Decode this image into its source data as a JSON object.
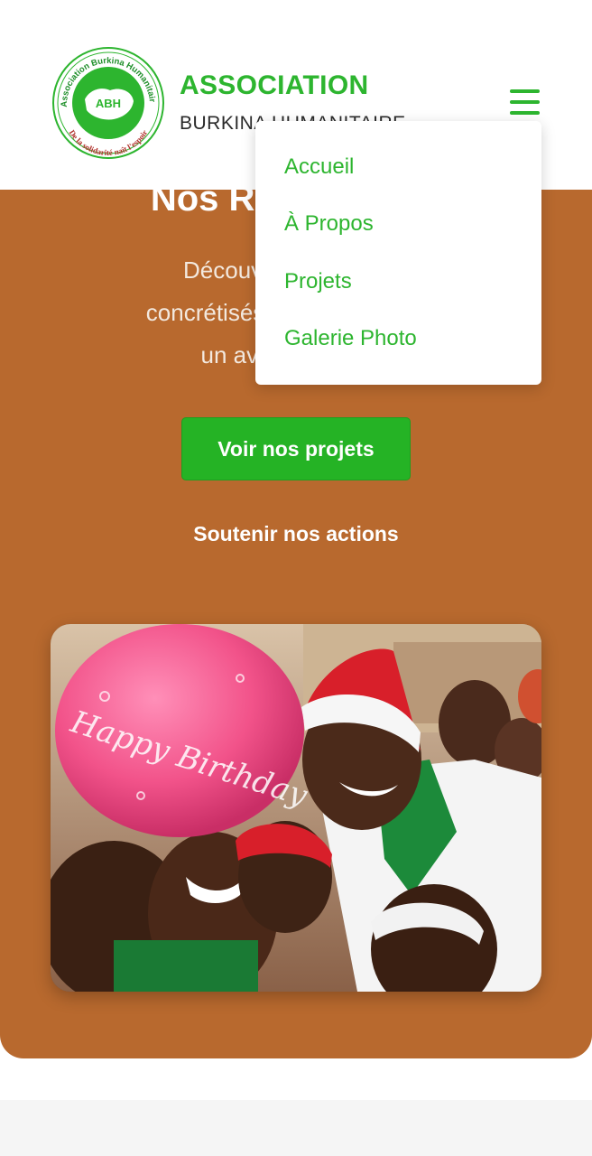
{
  "header": {
    "logo": {
      "ring_text": "Association Burkina Humanitaire",
      "ring_text_bottom": "De la solidarité naît l'espoir",
      "badge": "ABH"
    },
    "title": "ASSOCIATION",
    "subtitle": "BURKINA HUMANITAIRE",
    "menu_icon": "hamburger-menu-icon"
  },
  "nav": {
    "items": [
      {
        "label": "Accueil"
      },
      {
        "label": "À Propos"
      },
      {
        "label": "Projets"
      },
      {
        "label": "Galerie Photo"
      }
    ]
  },
  "hero": {
    "title": "Nos Réalisations",
    "text_line1": "Découvrez les projets",
    "text_line2": "concrétisés depuis pour bâtir",
    "text_line3": "un avenir meilleur.",
    "cta_label": "Voir nos projets",
    "support_label": "Soutenir nos actions",
    "balloon_text": "Happy Birthday"
  },
  "colors": {
    "brand_green": "#2db52f",
    "hero_bg": "#b8692e",
    "button_green": "#25b325"
  }
}
